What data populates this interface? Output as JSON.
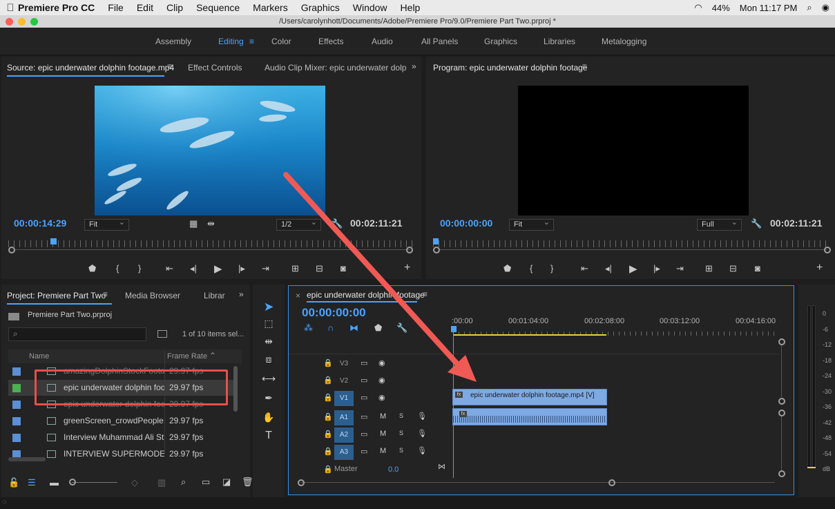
{
  "menubar": {
    "app": "Premiere Pro CC",
    "items": [
      "File",
      "Edit",
      "Clip",
      "Sequence",
      "Markers",
      "Graphics",
      "Window",
      "Help"
    ],
    "battery": "44%",
    "clock": "Mon 11:17 PM"
  },
  "window": {
    "title": "/Users/carolynhott/Documents/Adobe/Premiere Pro/9.0/Premiere Part Two.prproj *"
  },
  "workspaces": {
    "items": [
      "Assembly",
      "Editing",
      "Color",
      "Effects",
      "Audio",
      "All Panels",
      "Graphics",
      "Libraries",
      "Metalogging"
    ],
    "active": "Editing"
  },
  "source": {
    "tabs": [
      "Source: epic underwater dolphin footage.mp4",
      "Effect Controls",
      "Audio Clip Mixer: epic underwater dolp"
    ],
    "timecode": "00:00:14:29",
    "fit": "Fit",
    "resolution": "1/2",
    "duration": "00:02:11:21"
  },
  "program": {
    "tab": "Program: epic underwater dolphin footage",
    "timecode": "00:00:00:00",
    "fit": "Fit",
    "resolution": "Full",
    "duration": "00:02:11:21"
  },
  "project": {
    "tabs": [
      "Project: Premiere Part Two",
      "Media Browser",
      "Librar"
    ],
    "file": "Premiere Part Two.prproj",
    "selection": "1 of 10 items sel...",
    "columns": {
      "name": "Name",
      "fps": "Frame Rate"
    },
    "rows": [
      {
        "name": "amazingDolphinStockFootag",
        "fps": "29.97 fps",
        "color": "#5b8fd6"
      },
      {
        "name": "epic underwater dolphin foot",
        "fps": "29.97 fps",
        "color": "#4caf50"
      },
      {
        "name": "epic underwater dolphin foot",
        "fps": "29.97 fps",
        "color": "#5b8fd6"
      },
      {
        "name": "greenScreen_crowdPeople.m",
        "fps": "29.97 fps",
        "color": "#5b8fd6"
      },
      {
        "name": "Interview Muhammad Ali Stri",
        "fps": "29.97 fps",
        "color": "#5b8fd6"
      },
      {
        "name": "INTERVIEW SUPERMODEL TI",
        "fps": "29.97 fps",
        "color": "#5b8fd6"
      }
    ]
  },
  "timeline": {
    "tab": "epic underwater dolphin footage",
    "timecode": "00:00:00:00",
    "ruler": [
      ":00:00",
      "00:01:04:00",
      "00:02:08:00",
      "00:03:12:00",
      "00:04:16:00"
    ],
    "tracks": {
      "video": [
        "V3",
        "V2",
        "V1"
      ],
      "audio": [
        "A1",
        "A2",
        "A3"
      ],
      "master": "Master",
      "master_value": "0.0"
    },
    "clip_label": "epic underwater dolphin footage.mp4 [V]"
  },
  "meter": {
    "ticks": [
      "0",
      "-6",
      "-12",
      "-18",
      "-24",
      "-30",
      "-36",
      "-42",
      "-48",
      "-54",
      "dB"
    ]
  },
  "icons": {
    "mute": "M",
    "solo": "S"
  }
}
